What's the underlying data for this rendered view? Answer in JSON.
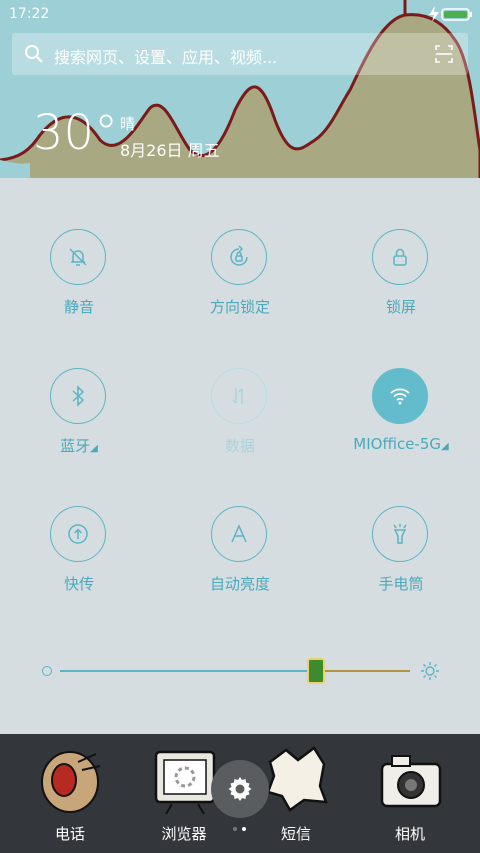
{
  "status_bar": {
    "time": "17:22"
  },
  "search": {
    "placeholder": "搜索网页、设置、应用、视频..."
  },
  "weather": {
    "temperature": "30°",
    "condition": "晴",
    "date": "8月26日 周五"
  },
  "toggles": [
    {
      "label": "静音",
      "icon": "silent-bell-icon",
      "state": "off"
    },
    {
      "label": "方向锁定",
      "icon": "rotation-lock-icon",
      "state": "off"
    },
    {
      "label": "锁屏",
      "icon": "lock-icon",
      "state": "off"
    },
    {
      "label": "蓝牙",
      "icon": "bluetooth-icon",
      "state": "off"
    },
    {
      "label": "数据",
      "icon": "mobile-data-icon",
      "state": "disabled"
    },
    {
      "label": "MIOffice-5G",
      "icon": "wifi-icon",
      "state": "on"
    },
    {
      "label": "快传",
      "icon": "transfer-icon",
      "state": "off"
    },
    {
      "label": "自动亮度",
      "icon": "auto-brightness-icon",
      "state": "off"
    },
    {
      "label": "手电筒",
      "icon": "flashlight-icon",
      "state": "off"
    }
  ],
  "brightness": {
    "level": 0.73
  },
  "dock": {
    "apps": [
      {
        "name": "电话"
      },
      {
        "name": "浏览器"
      },
      {
        "name": "短信"
      },
      {
        "name": "相机"
      }
    ]
  },
  "colors": {
    "accent": "#5db4c4",
    "active": "#62bccb",
    "panel_bg": "#d5dde0",
    "wallpaper_sky": "#9dcfd6"
  }
}
